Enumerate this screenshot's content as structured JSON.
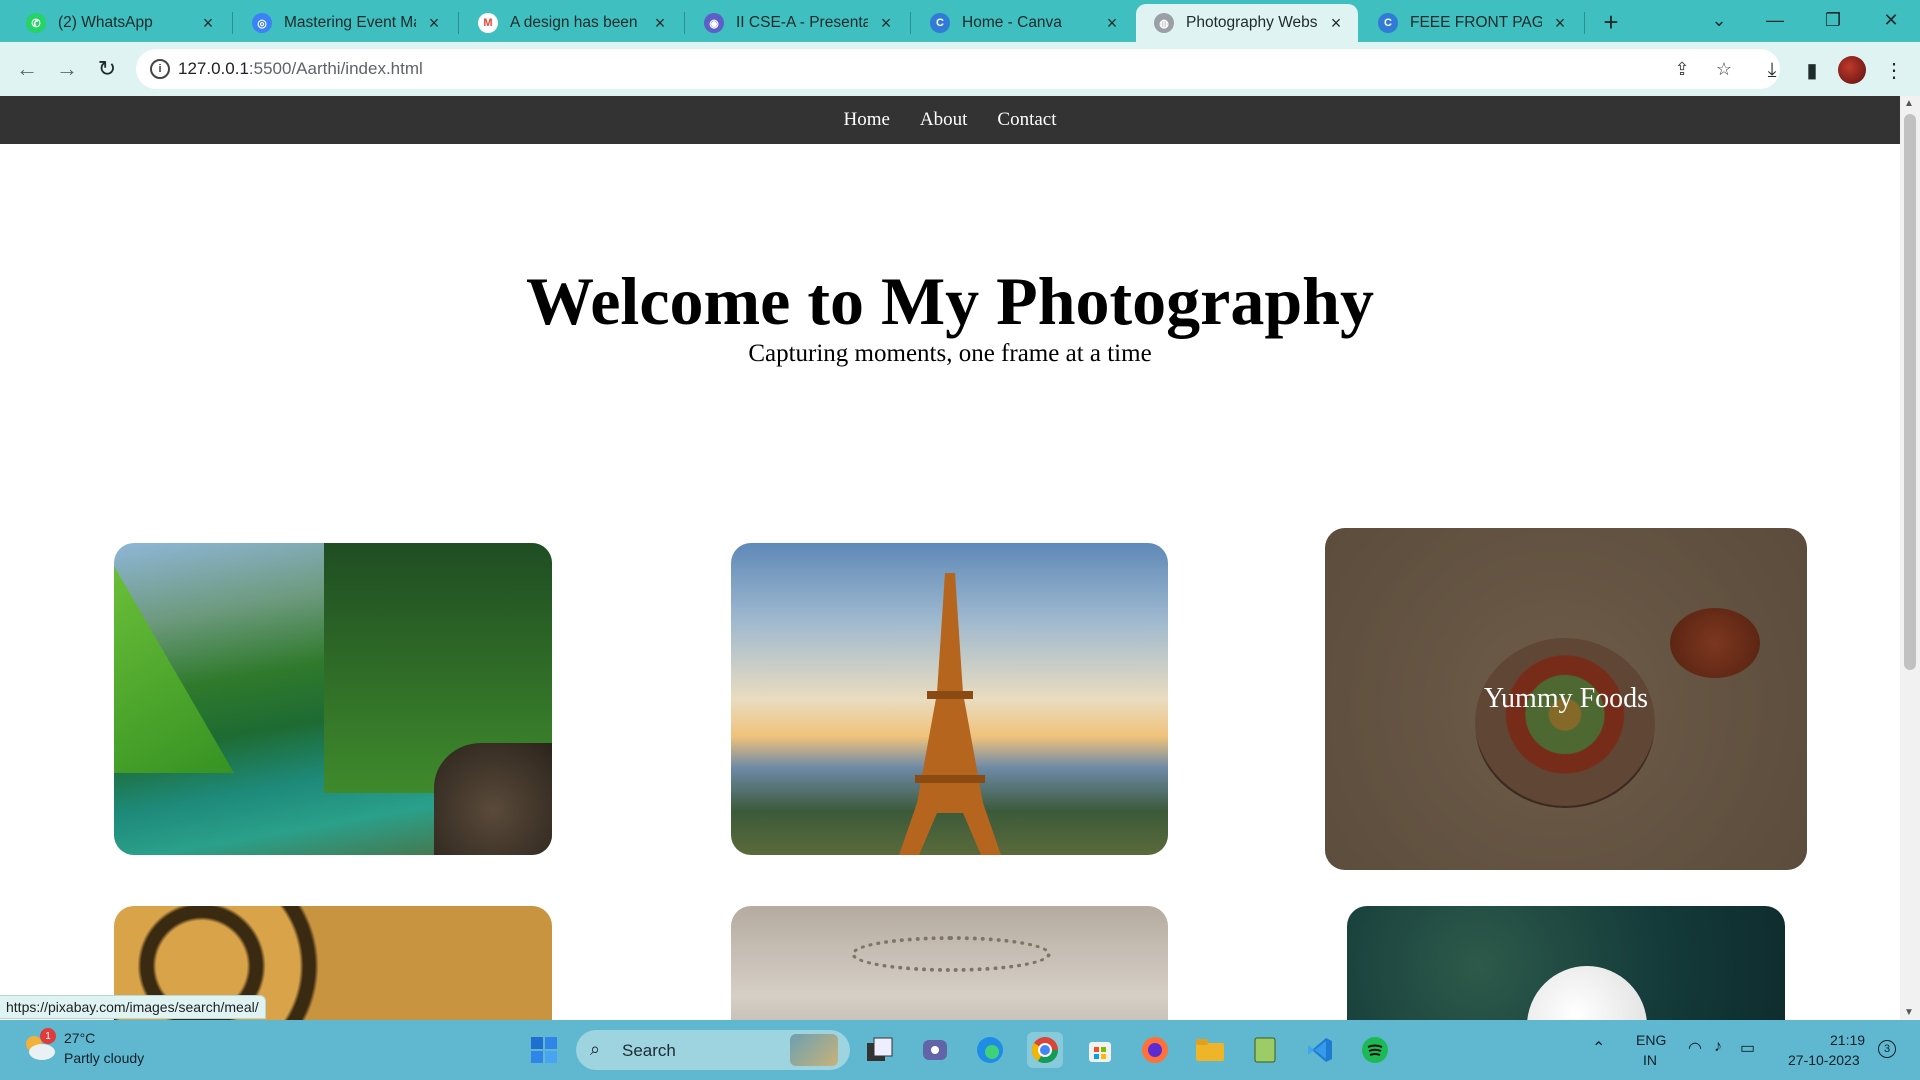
{
  "browser": {
    "tabs": [
      {
        "label": "(2) WhatsApp",
        "icon": "whatsapp-icon",
        "color": "#25d366",
        "glyph": "✆"
      },
      {
        "label": "Mastering Event Man",
        "icon": "web-globe-icon",
        "color": "#3b82f6",
        "glyph": "◎"
      },
      {
        "label": "A design has been sh",
        "icon": "gmail-icon",
        "color": "#ea4335",
        "glyph": "M"
      },
      {
        "label": "II CSE-A - Presentatio",
        "icon": "teams-icon",
        "color": "#5b5fc7",
        "glyph": "◉"
      },
      {
        "label": "Home - Canva",
        "icon": "canva-icon",
        "color": "#2f7bd6",
        "glyph": "C"
      },
      {
        "label": "Photography Website",
        "icon": "globe-icon",
        "color": "#9aa0a6",
        "glyph": "◍",
        "active": true
      },
      {
        "label": "FEEE FRONT PAGE.pd",
        "icon": "canva-icon",
        "color": "#2f7bd6",
        "glyph": "C"
      }
    ],
    "url_host": "127.0.0.1",
    "url_path": ":5500/Aarthi/index.html",
    "status_url": "https://pixabay.com/images/search/meal/"
  },
  "site": {
    "nav": [
      "Home",
      "About",
      "Contact"
    ],
    "title": "Welcome to My Photography",
    "subtitle": "Capturing moments, one frame at a time",
    "cards": [
      {
        "name": "mountain-lake-photo",
        "overlay": ""
      },
      {
        "name": "eiffel-tower-photo",
        "overlay": ""
      },
      {
        "name": "food-bowl-photo",
        "overlay": "Yummy Foods"
      },
      {
        "name": "leopard-photo",
        "overlay": ""
      },
      {
        "name": "hat-woman-photo",
        "overlay": ""
      },
      {
        "name": "eagle-photo",
        "overlay": ""
      }
    ]
  },
  "taskbar": {
    "temperature": "27°C",
    "weather": "Partly cloudy",
    "weather_badge": "1",
    "search_placeholder": "Search",
    "lang_1": "ENG",
    "lang_2": "IN",
    "time": "21:19",
    "date": "27-10-2023",
    "notification_count": "3"
  }
}
